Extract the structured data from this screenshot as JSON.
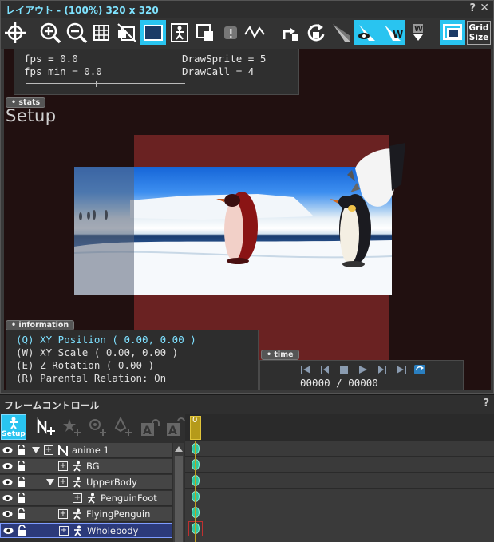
{
  "layout_window": {
    "title": "レイアウト - (100%) 320 x 320",
    "help": "?",
    "close": "✕"
  },
  "toolbar": {
    "grid_size_label_1": "Grid",
    "grid_size_label_2": "Size",
    "pin_label": "W",
    "pin2_label": "W"
  },
  "stats": {
    "fps": "fps = 0.0",
    "fps_min": "fps min = 0.0",
    "draw_sprite": "DrawSprite = 5",
    "draw_call": "DrawCall = 4",
    "tag": "stats"
  },
  "mode_label": "Setup",
  "information": {
    "tag": "information",
    "lines": [
      "(Q) XY Position ( 0.00, 0.00 )",
      "(W) XY Scale ( 0.00, 0.00 )",
      "(E) Z Rotation ( 0.00 )",
      "(R) Parental Relation: On"
    ]
  },
  "time": {
    "tag": "time",
    "readout": "00000 / 00000"
  },
  "frame_control": {
    "title": "フレームコントロール",
    "help": "?",
    "setup_label": "Setup",
    "cursor_frame": "0",
    "tree": [
      {
        "label": "anime 1",
        "depth": 0,
        "type": "animation",
        "expander": true
      },
      {
        "label": "BG",
        "depth": 1,
        "type": "part",
        "expander": false
      },
      {
        "label": "UpperBody",
        "depth": 1,
        "type": "part",
        "expander": true
      },
      {
        "label": "PenguinFoot",
        "depth": 2,
        "type": "part",
        "expander": false
      },
      {
        "label": "FlyingPenguin",
        "depth": 1,
        "type": "part",
        "expander": false
      },
      {
        "label": "Wholebody",
        "depth": 1,
        "type": "part",
        "expander": false,
        "selected": true
      }
    ]
  },
  "colors": {
    "accent": "#29c4f0",
    "title_cyan": "#7fe3ff",
    "stage": "#6a2222",
    "viewport": "#211010",
    "keyframe": "#2fc7a0",
    "selected_row": "#2c3a7a"
  }
}
